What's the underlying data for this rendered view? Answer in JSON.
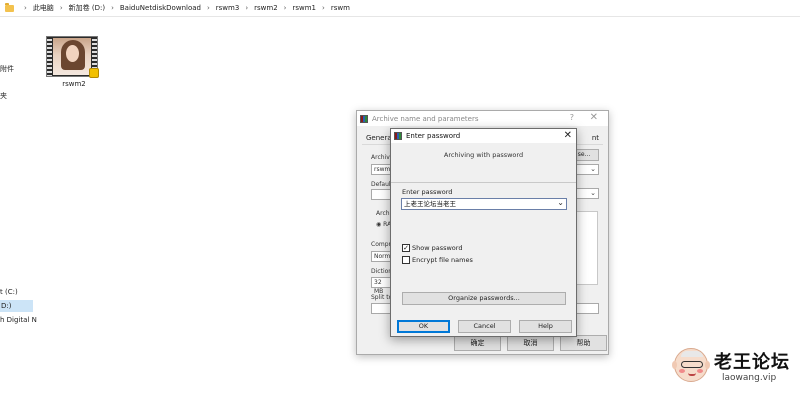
{
  "explorer": {
    "breadcrumb": [
      "此电脑",
      "新加卷 (D:)",
      "BaiduNetdiskDownload",
      "rswm3",
      "rswm2",
      "rswm1",
      "rswm"
    ],
    "nav_fragments": [
      "附件",
      "夹",
      "t (C:)",
      "D:)",
      "h Digital N"
    ],
    "file": {
      "name": "rswm2"
    }
  },
  "back_dialog": {
    "title": "Archive name and parameters",
    "help_glyph": "?",
    "close_glyph": "✕",
    "tabs": [
      "General",
      "nt"
    ],
    "fragments": {
      "archive_label": "Archiv",
      "archive_value": "rswm8",
      "browse": "se...",
      "default_label": "Defaul",
      "archive_format": "Archiv",
      "format_radio": "RA",
      "compression_label": "Compre",
      "compression_value": "Norma",
      "dictionary_label": "Dictiona",
      "dictionary_value": "32 MB",
      "split_label": "Split to"
    },
    "buttons": {
      "ok": "确定",
      "cancel": "取消",
      "help": "帮助"
    }
  },
  "password_dialog": {
    "title": "Enter password",
    "close_glyph": "✕",
    "subtitle": "Archiving with password",
    "password_label": "Enter password",
    "password_value": "上老王论坛当老王",
    "show_password": {
      "label": "Show password",
      "checked": true
    },
    "encrypt_names": {
      "label": "Encrypt file names",
      "checked": false
    },
    "organize": "Organize passwords...",
    "buttons": {
      "ok": "OK",
      "cancel": "Cancel",
      "help": "Help"
    }
  },
  "watermark": {
    "title": "老王论坛",
    "url": "laowang.vip"
  }
}
